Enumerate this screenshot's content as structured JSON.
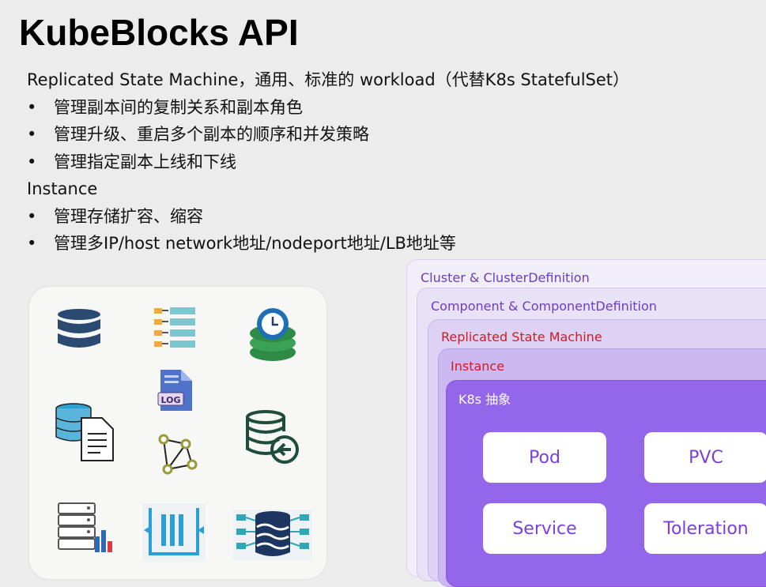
{
  "title": "KubeBlocks API",
  "rsm": {
    "heading": "Replicated State Machine，通用、标准的 workload（代替K8s StatefulSet）",
    "bullets": [
      "管理副本间的复制关系和副本角色",
      "管理升级、重启多个副本的顺序和并发策略",
      "管理指定副本上线和下线"
    ]
  },
  "instance": {
    "heading": "Instance",
    "bullets": [
      "管理存储扩容、缩容",
      "管理多IP/host network地址/nodeport地址/LB地址等"
    ]
  },
  "layers": {
    "cluster": "Cluster & ClusterDefinition",
    "component": "Component & ComponentDefinition",
    "rsm": "Replicated State Machine",
    "instance": "Instance",
    "k8s": "K8s 抽象"
  },
  "cards": [
    "Pod",
    "PVC",
    "Service",
    "Toleration"
  ],
  "icons": [
    "database-icon",
    "queue-list-icon",
    "database-clock-icon",
    "log-file-icon",
    "database-document-icon",
    "network-graph-icon",
    "database-restore-icon",
    "database-chart-icon",
    "pipeline-icon",
    "data-stream-icon"
  ],
  "colors": {
    "layer_text": "#6a3fc2",
    "highlight_text": "#d01c24",
    "k8s_box": "#9466ea",
    "card_text": "#7b3fe0"
  }
}
